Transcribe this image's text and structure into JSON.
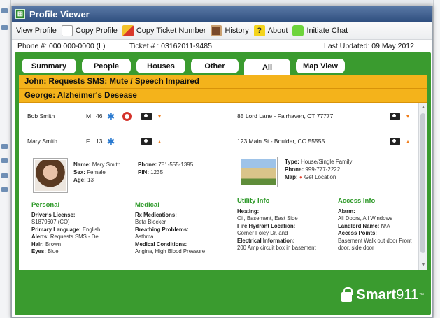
{
  "window": {
    "title": "Profile Viewer"
  },
  "toolbar": {
    "view_profile": "View Profile",
    "copy_profile": "Copy Profile",
    "copy_ticket": "Copy Ticket Number",
    "history": "History",
    "about": "About",
    "chat": "Initiate Chat",
    "about_icon_glyph": "?"
  },
  "info": {
    "phone": "Phone #: 000 000-0000 (L)",
    "ticket": "Ticket # : 03162011-9485",
    "updated": "Last Updated: 09 May 2012"
  },
  "tabs": [
    "Summary",
    "People",
    "Houses",
    "Other",
    "All",
    "Map View"
  ],
  "active_tab": "All",
  "alerts": [
    "John: Requests SMS: Mute / Speech Impaired",
    "George: Alzheimer's Desease"
  ],
  "people": [
    {
      "name": "Bob Smith",
      "sex": "M",
      "age": "46",
      "caret": "▾"
    },
    {
      "name": "Mary Smith",
      "sex": "F",
      "age": "13",
      "caret": "▴"
    }
  ],
  "addresses": [
    {
      "address": "85 Lord Lane - Fairhaven, CT 77777",
      "caret": "▾"
    },
    {
      "address": "123 Main St - Boulder, CO 55555",
      "caret": "▴"
    }
  ],
  "person_detail": {
    "name": "Mary Smith",
    "name_label": "Name:",
    "sex_label": "Sex:",
    "sex": "Female",
    "age_label": "Age:",
    "age": "13",
    "phone_label": "Phone:",
    "phone": "781-555-1395",
    "pin_label": "PIN:",
    "pin": "1235"
  },
  "house_detail": {
    "type_label": "Type:",
    "type": "House/Single Family",
    "phone_label": "Phone:",
    "phone": "999-777-2222",
    "map_label": "Map:",
    "map_link": "Get Location"
  },
  "personal": {
    "title": "Personal",
    "drivers_license_label": "Driver's License:",
    "drivers_license": "S1879607 (CO)",
    "language_label": "Primary Language:",
    "language": "English",
    "alerts_label": "Alerts:",
    "alerts": "Requests SMS - De",
    "hair_label": "Hair:",
    "hair": "Brown",
    "eyes_label": "Eyes:",
    "eyes": "Blue"
  },
  "medical": {
    "title": "Medical",
    "rx_label": "Rx Medications:",
    "rx": "Beta Blocker",
    "breathing_label": "Breathing Problems:",
    "breathing": "Asthma",
    "conditions_label": "Medical Conditions:",
    "conditions": "Angina, High Blood Pressure"
  },
  "utility": {
    "title": "Utility Info",
    "heating_label": "Heating:",
    "heating": "Oil, Basement, East Side",
    "hydrant_label": "Fire Hydrant Location:",
    "hydrant": "Corner Foley Dr. and",
    "electrical_label": "Electrical Information:",
    "electrical": "200 Amp circuit box in basement"
  },
  "access": {
    "title": "Access Info",
    "alarm_label": "Alarm:",
    "alarm": "All Doors, All Windows",
    "landlord_label": "Landlord Name:",
    "landlord": "N/A",
    "access_points_label": "Access Points:",
    "access_points": "Basement Walk out door Front door, side door"
  },
  "brand": {
    "smart": "Smart",
    "num": "911",
    "tm": "™"
  },
  "colors": {
    "panel_green": "#3a9b2f",
    "alert_orange": "#f4b31b",
    "title_blue": "#2f4f7f",
    "section_green": "#2f9a2a"
  }
}
